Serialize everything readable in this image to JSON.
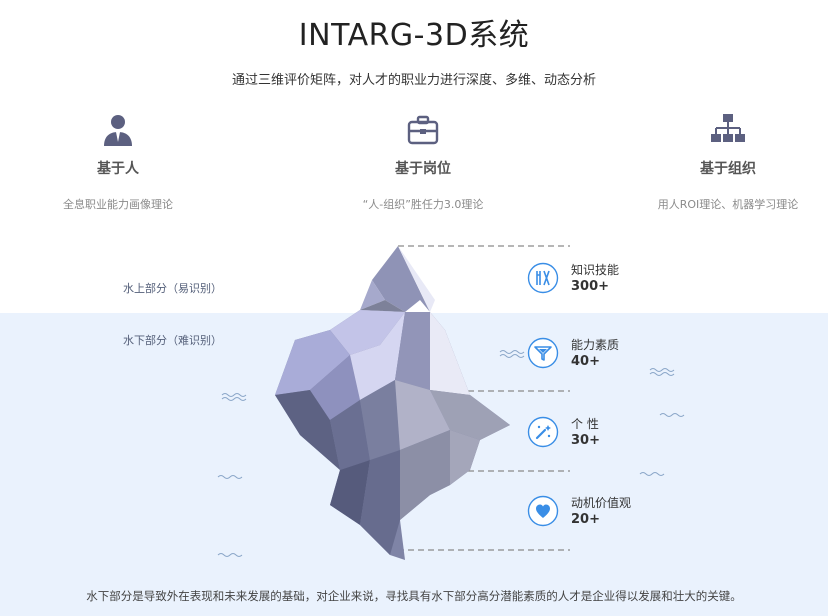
{
  "header": {
    "title": "INTARG-3D系统",
    "subtitle": "通过三维评价矩阵，对人才的职业力进行深度、多维、动态分析"
  },
  "features": [
    {
      "icon": "person-icon",
      "name": "基于人",
      "desc": "全息职业能力画像理论"
    },
    {
      "icon": "briefcase-icon",
      "name": "基于岗位",
      "desc": "“人-组织”胜任力3.0理论"
    },
    {
      "icon": "org-chart-icon",
      "name": "基于组织",
      "desc": "用人ROI理论、机器学习理论"
    }
  ],
  "iceberg": {
    "above_label": "水上部分（易识别）",
    "below_label": "水下部分（难识别）",
    "metrics": [
      {
        "icon": "tools-icon",
        "name": "知识技能",
        "value": "300+"
      },
      {
        "icon": "funnel-icon",
        "name": "能力素质",
        "value": "40+"
      },
      {
        "icon": "magic-wand-icon",
        "name": "个 性",
        "value": "30+"
      },
      {
        "icon": "heart-icon",
        "name": "动机价值观",
        "value": "20+"
      }
    ]
  },
  "footer": {
    "text": "水下部分是导致外在表现和未来发展的基础，对企业来说，寻找具有水下部分高分潜能素质的人才是企业得以发展和壮大的关键。"
  },
  "colors": {
    "accent": "#3a8ee6",
    "water": "#eaf2fd",
    "iceberg_dark": "#5f6585",
    "iceberg_light": "#b7b9dd"
  }
}
